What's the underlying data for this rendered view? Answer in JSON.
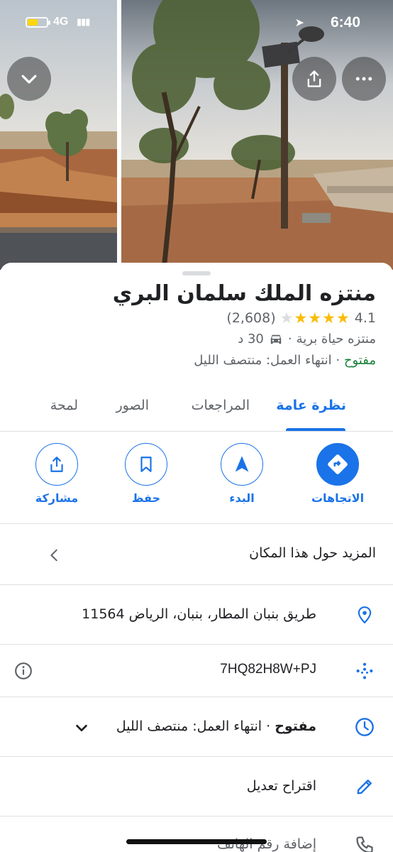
{
  "status_bar": {
    "network": "4G",
    "time": "6:40",
    "battery_level": 0.55,
    "battery_color": "#ffd60a"
  },
  "place": {
    "name": "منتزه الملك سلمان البري",
    "rating": "4.1",
    "rating_value": 4.1,
    "review_count": "(2,608)",
    "category": "منتزه حياة برية",
    "separator": "·",
    "drive_time": "30 د",
    "open_status": "مفتوح",
    "closes_text": "انتهاء العمل: منتصف الليل"
  },
  "tabs": [
    {
      "label": "نظرة عامة",
      "active": true
    },
    {
      "label": "المراجعات",
      "active": false
    },
    {
      "label": "الصور",
      "active": false
    },
    {
      "label": "لمحة",
      "active": false
    }
  ],
  "actions": {
    "directions": "الاتجاهات",
    "start": "البدء",
    "save": "حفظ",
    "share": "مشاركة"
  },
  "details": {
    "more_about": "المزيد حول هذا المكان",
    "address": "طريق بنبان المطار، بنبان، الرياض 11564",
    "plus_code": "7HQ82H8W+PJ",
    "hours_open": "مفتوح",
    "hours_rest": " · انتهاء العمل: منتصف الليل",
    "suggest_edit": "اقتراح تعديل",
    "add_phone": "إضافة رقم الهاتف"
  },
  "colors": {
    "accent": "#1a73e8",
    "open_green": "#188038",
    "star": "#fbbc04",
    "muted_text": "#5f6368"
  },
  "icons": [
    "chevron-down-icon",
    "share-icon",
    "more-icon",
    "directions-icon",
    "navigation-arrow-icon",
    "bookmark-icon",
    "location-pin-icon",
    "plus-code-icon",
    "info-icon",
    "clock-icon",
    "pencil-icon",
    "phone-icon",
    "car-icon",
    "chevron-left-icon"
  ]
}
